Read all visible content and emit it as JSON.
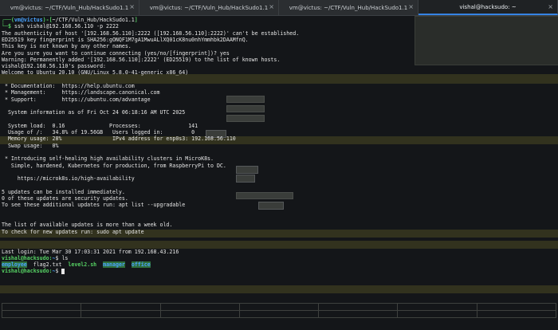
{
  "tabs": [
    {
      "title": "vm@victus: ~/CTF/Vuln_Hub/HackSudo1.1",
      "active": false
    },
    {
      "title": "vm@victus: ~/CTF/Vuln_Hub/HackSudo1.1",
      "active": false
    },
    {
      "title": "vm@victus: ~/CTF/Vuln_Hub/HackSudo1.1",
      "active": false
    },
    {
      "title": "vishal@hacksudo: ~",
      "active": true
    }
  ],
  "terminal": {
    "prompt1": {
      "user": "vm@victus",
      "path": "~/CTF/Vuln_Hub/HackSudo1.1",
      "command": "ssh vishal@192.168.56.110 -p 2222"
    },
    "ssh_lines": [
      "The authenticity of host '[192.168.56.110]:2222 ([192.168.56.110]:2222)' can't be established.",
      "ED25519 key fingerprint is SHA256:gONQF1M7gA1MwuALlXQ01cK8nu0nhYmmhbk2DAAMfnQ.",
      "This key is not known by any other names.",
      "Are you sure you want to continue connecting (yes/no/[fingerprint])? yes",
      "Warning: Permanently added '[192.168.56.110]:2222' (ED25519) to the list of known hosts.",
      "vishal@192.168.56.110's password:",
      "Welcome to Ubuntu 20.10 (GNU/Linux 5.8.0-41-generic x86_64)"
    ],
    "docs": [
      " * Documentation:  https://help.ubuntu.com",
      " * Management:     https://landscape.canonical.com",
      " * Support:        https://ubuntu.com/advantage"
    ],
    "sysinfo_header": "  System information as of Fri Oct 24 06:18:16 AM UTC 2025",
    "sysinfo": [
      "  System load:  0.16              Processes:               141",
      "  Usage of /:   34.8% of 19.56GB   Users logged in:         0",
      "  Memory usage: 28%                IPv4 address for enp0s3: 192.168.56.110",
      "  Swap usage:   0%"
    ],
    "microk8s": [
      " * Introducing self-healing high availability clusters in MicroK8s.",
      "   Simple, hardened, Kubernetes for production, from RaspberryPi to DC.",
      "",
      "     https://microk8s.io/high-availability"
    ],
    "updates": [
      "5 updates can be installed immediately.",
      "0 of these updates are security updates.",
      "To see these additional updates run: apt list --upgradable"
    ],
    "stale": [
      "The list of available updates is more than a week old.",
      "To check for new updates run: sudo apt update"
    ],
    "last_login": "Last login: Tue Mar 30 17:03:31 2021 from 192.168.43.216",
    "prompt2": {
      "user": "vishal@hacksudo",
      "path": "~",
      "command": "ls"
    },
    "ls_output": [
      {
        "name": "employee",
        "type": "dir"
      },
      {
        "name": "flag2.txt",
        "type": "file"
      },
      {
        "name": "level2.sh",
        "type": "exec"
      },
      {
        "name": "manager",
        "type": "dir"
      },
      {
        "name": "office",
        "type": "dir"
      }
    ],
    "prompt3": {
      "user": "vishal@hacksudo",
      "path": "~",
      "command": ""
    }
  },
  "colors": {
    "prompt_user": "#56d364",
    "prompt_path": "#4aa3ff",
    "text": "#e6e6e6",
    "tab_accent": "#3584e4"
  }
}
